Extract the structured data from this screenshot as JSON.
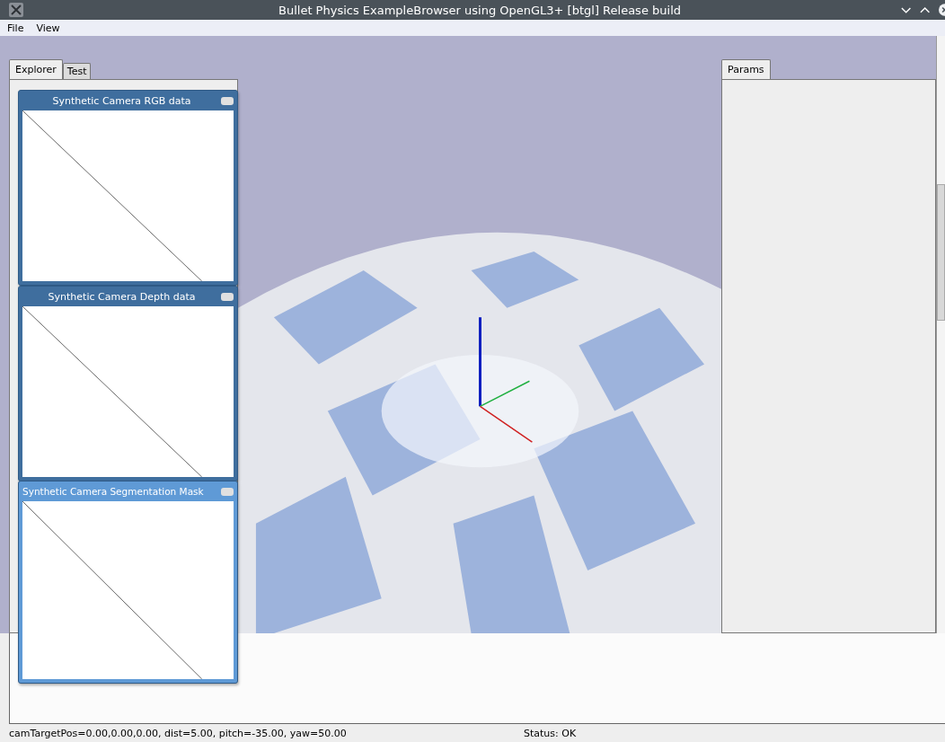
{
  "window": {
    "title": "Bullet Physics ExampleBrowser using OpenGL3+ [btgl] Release build"
  },
  "menu": [
    "File",
    "View"
  ],
  "left_tabs": [
    {
      "label": "Explorer",
      "selected": true
    },
    {
      "label": "Test",
      "selected": false
    }
  ],
  "right_tabs": [
    {
      "label": "Params",
      "selected": true
    }
  ],
  "scene": {
    "kind": "picture"
  },
  "camera_windows": [
    {
      "title": "Synthetic Camera RGB data",
      "focused": false
    },
    {
      "title": "Synthetic Camera Depth data",
      "focused": false
    },
    {
      "title": "Synthetic Camera Segmentation Mask",
      "focused": true
    }
  ],
  "status_bar": {
    "camera": "camTargetPos=0.00,0.00,0.00, dist=5.00, pitch=-35.00, yaw=50.00",
    "status": "Status: OK"
  }
}
